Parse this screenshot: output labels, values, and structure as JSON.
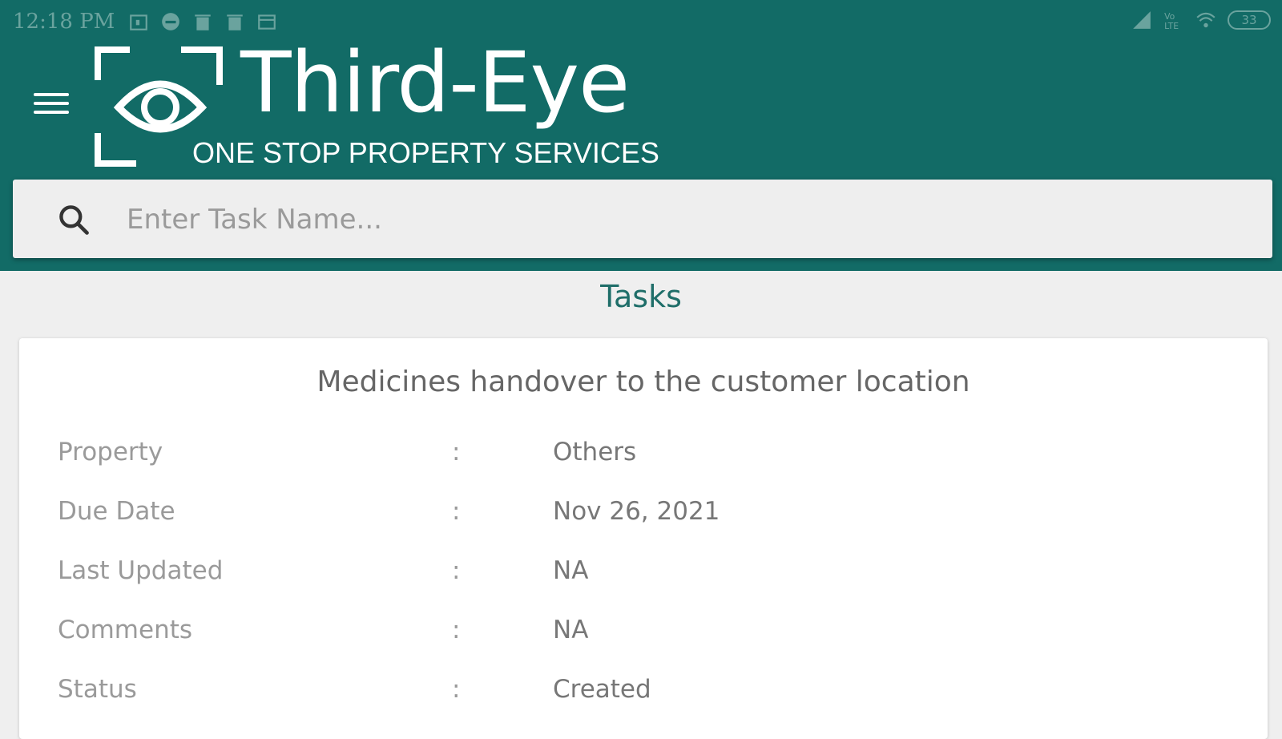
{
  "status_bar": {
    "time": "12:18 PM",
    "left_icons": [
      "calendar-icon",
      "message-icon",
      "trash-icon",
      "trash-icon",
      "card-icon"
    ],
    "right_icons": [
      "signal-icon",
      "volte-icon",
      "wifi-icon"
    ],
    "battery": "33"
  },
  "header": {
    "brand_title": "Third-Eye",
    "brand_subtitle": "ONE STOP PROPERTY SERVICES",
    "background_color": "#126b66"
  },
  "search": {
    "placeholder": "Enter Task Name..."
  },
  "page_title": "Tasks",
  "task_card": {
    "title": "Medicines handover to the customer location",
    "fields": [
      {
        "label": "Property",
        "colon": ":",
        "value": "Others"
      },
      {
        "label": "Due Date",
        "colon": ":",
        "value": "Nov 26, 2021"
      },
      {
        "label": "Last Updated",
        "colon": ":",
        "value": "NA"
      },
      {
        "label": "Comments",
        "colon": ":",
        "value": "NA"
      },
      {
        "label": "Status",
        "colon": ":",
        "value": "Created"
      }
    ]
  }
}
